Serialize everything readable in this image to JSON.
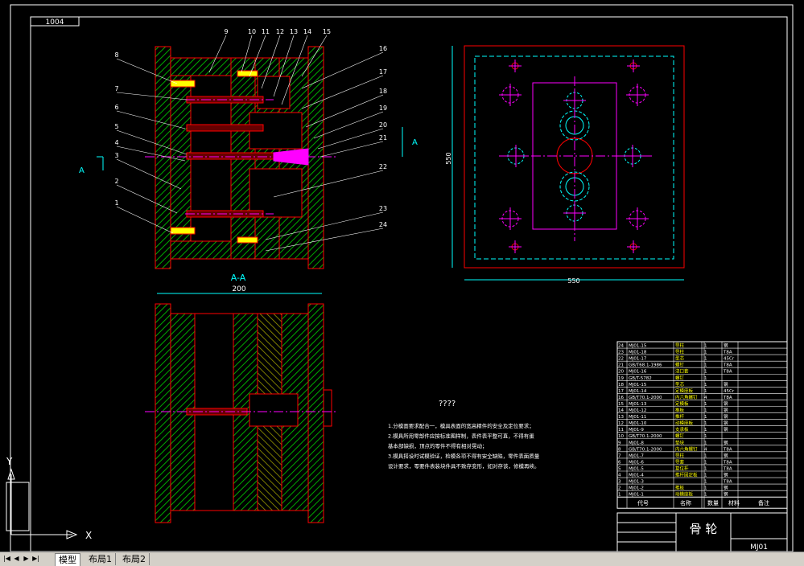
{
  "title_box_label": "1004",
  "section_title": "A-A",
  "section_marker": "A",
  "dim_plan_width": "550",
  "dim_plan_height": "550",
  "dim_section_width": "200",
  "part_callouts": [
    "1",
    "2",
    "3",
    "4",
    "5",
    "6",
    "7",
    "8",
    "9",
    "10",
    "11",
    "12",
    "13",
    "14",
    "15",
    "16",
    "17",
    "18",
    "19",
    "20",
    "21",
    "22",
    "23",
    "24"
  ],
  "notes_heading": "????",
  "notes": [
    "1.分模面要求配合一，模具表面的宽高精件的安全及定位要求；",
    "2.模具所用零部件应按标准图样制，表件表平整可直，不得有蛋",
    "  基本部缺损，顶点的零件不得有相对晃动；",
    "3.模具搭设时试模验证，检模各项不得有安全缺陷，零件表面质量",
    "  设计要求，零要件表装块件具不致存变形，如对存该，修模再续。"
  ],
  "bom": [
    {
      "no": "24",
      "code": "MJ01-15",
      "name": "导柱",
      "qty": "1",
      "mat": "钢"
    },
    {
      "no": "23",
      "code": "MJ01-18",
      "name": "导柱",
      "qty": "1",
      "mat": "T8A"
    },
    {
      "no": "22",
      "code": "MJ01-17",
      "name": "型芯",
      "qty": "1",
      "mat": "45Cr"
    },
    {
      "no": "21",
      "code": "GB/T68.1-1986",
      "name": "螺钉",
      "qty": "1",
      "mat": "T8A"
    },
    {
      "no": "20",
      "code": "MJ01-16",
      "name": "浇口套",
      "qty": "1",
      "mat": "T8A"
    },
    {
      "no": "19",
      "code": "GB/T-5782",
      "name": "螺钉",
      "qty": "1",
      "mat": ""
    },
    {
      "no": "18",
      "code": "MJ01-15",
      "name": "型芯",
      "qty": "1",
      "mat": "钢"
    },
    {
      "no": "17",
      "code": "MJ01-14",
      "name": "定模座板",
      "qty": "1",
      "mat": "45Cr"
    },
    {
      "no": "16",
      "code": "GB/T70.1-2000",
      "name": "内六角螺钉",
      "qty": "4",
      "mat": "T8A"
    },
    {
      "no": "15",
      "code": "MJ01-13",
      "name": "定模板",
      "qty": "1",
      "mat": "钢"
    },
    {
      "no": "14",
      "code": "MJ01-12",
      "name": "推板",
      "qty": "1",
      "mat": "钢"
    },
    {
      "no": "13",
      "code": "MJ01-11",
      "name": "推杆",
      "qty": "1",
      "mat": "钢"
    },
    {
      "no": "12",
      "code": "MJ01-10",
      "name": "动模座板",
      "qty": "1",
      "mat": "钢"
    },
    {
      "no": "11",
      "code": "MJ01-9",
      "name": "支承板",
      "qty": "1",
      "mat": "钢"
    },
    {
      "no": "10",
      "code": "GB/T70.1-2000",
      "name": "螺钉",
      "qty": "1",
      "mat": ""
    },
    {
      "no": "9",
      "code": "MJ01-8",
      "name": "垫块",
      "qty": "1",
      "mat": "钢"
    },
    {
      "no": "8",
      "code": "GB/T70.1-2000",
      "name": "内六角螺钉",
      "qty": "4",
      "mat": "T8A"
    },
    {
      "no": "7",
      "code": "MJ01-7",
      "name": "导柱",
      "qty": "1",
      "mat": "钢"
    },
    {
      "no": "6",
      "code": "MJ01-6",
      "name": "导套",
      "qty": "1",
      "mat": "T8A"
    },
    {
      "no": "5",
      "code": "MJ01-5",
      "name": "复位杆",
      "qty": "1",
      "mat": "T8A"
    },
    {
      "no": "4",
      "code": "MJ01-4",
      "name": "推杆固定板",
      "qty": "1",
      "mat": "钢"
    },
    {
      "no": "3",
      "code": "MJ01-3",
      "name": "",
      "qty": "1",
      "mat": "T8A"
    },
    {
      "no": "2",
      "code": "MJ01-2",
      "name": "推板",
      "qty": "1",
      "mat": "钢"
    },
    {
      "no": "1",
      "code": "MJ01-1",
      "name": "动模座板",
      "qty": "1",
      "mat": "钢"
    }
  ],
  "bom_header": {
    "code": "代号",
    "name": "名称",
    "qty": "数量",
    "mat": "材料",
    "note": "备注"
  },
  "title_block": {
    "part_name": "骨 轮",
    "drawing_no": "MJ01"
  },
  "ucs": {
    "x": "X",
    "y": "Y"
  },
  "tabs": [
    "模型",
    "布局1",
    "布局2"
  ],
  "nav_buttons": [
    "|◀",
    "◀",
    "▶",
    "▶|"
  ],
  "colors": {
    "background": "#000000",
    "outline": "#ff0000",
    "part": "#00ff00",
    "dim": "#00ffff",
    "center": "#ff00ff",
    "hatch": "#ffff00",
    "text": "#ffffff"
  }
}
